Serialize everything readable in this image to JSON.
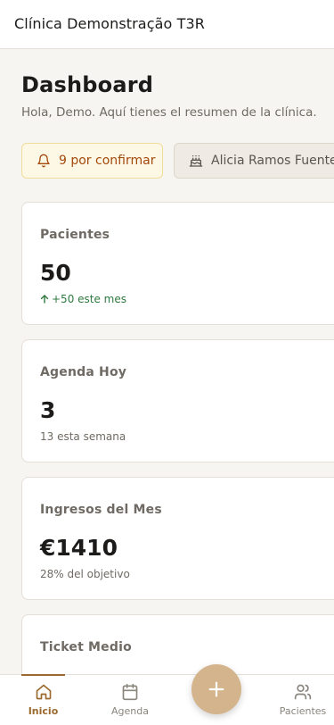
{
  "header": {
    "clinic_name": "Clínica Demonstração T3R"
  },
  "dashboard": {
    "title": "Dashboard",
    "subtitle": "Hola, Demo. Aquí tienes el resumen de la clínica."
  },
  "chips": {
    "pending_label": "9 por confirmar",
    "pending_icon": "bell-icon",
    "birthday_label": "Alicia Ramos Fuentes",
    "birthday_icon": "cake-icon"
  },
  "cards": [
    {
      "label": "Pacientes",
      "value": "50",
      "meta": "+50 este mes",
      "trend": "up"
    },
    {
      "label": "Agenda Hoy",
      "value": "3",
      "meta": "13 esta semana"
    },
    {
      "label": "Ingresos del Mes",
      "value": "€1410",
      "meta": "28% del objetivo"
    },
    {
      "label": "Ticket Medio",
      "value": "",
      "meta": ""
    }
  ],
  "nav": {
    "items": [
      {
        "label": "Inicio",
        "icon": "home-icon",
        "active": true
      },
      {
        "label": "Agenda",
        "icon": "calendar-icon"
      },
      {
        "label": "Pacientes",
        "icon": "users-icon"
      }
    ],
    "fab_icon": "plus-icon"
  },
  "colors": {
    "accent": "#9b6a2f",
    "fab": "#d4b48c",
    "trend_up": "#2f7a3e",
    "warning_text": "#a34a0a"
  }
}
